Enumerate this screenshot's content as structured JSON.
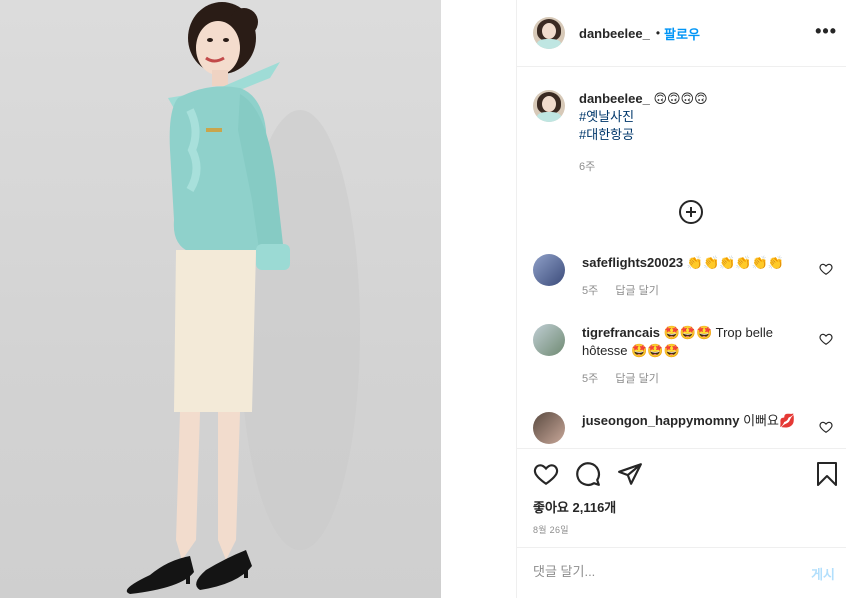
{
  "post": {
    "author": "danbeelee_",
    "dot": "•",
    "follow_label": "팔로우",
    "more_label": "•••"
  },
  "caption": {
    "author": "danbeelee_",
    "emojis": "🙃🙃🙃🙃",
    "hashtags": [
      "#옛날사진",
      "#대한항공"
    ],
    "time": "6주"
  },
  "comments": [
    {
      "user": "safeflights20023",
      "text": "👏👏👏👏👏👏",
      "time": "5주",
      "reply": "답글 달기"
    },
    {
      "user": "tigrefrancais",
      "text": "🤩🤩🤩 Trop belle hôtesse 🤩🤩🤩",
      "time": "5주",
      "reply": "답글 달기"
    },
    {
      "user": "juseongon_happymomny",
      "text": "이뻐요💋",
      "time": "",
      "reply": ""
    }
  ],
  "likes": "좋아요 2,116개",
  "date": "8월 26일",
  "comment_input": {
    "placeholder": "댓글 달기..."
  },
  "post_button": "게시",
  "icons": [
    "heart-icon",
    "comment-icon",
    "share-icon",
    "bookmark-icon",
    "plus-circle-icon"
  ],
  "colors": {
    "accent": "#0095f6",
    "uniform": "#8fd1cb",
    "skirt": "#f3ead8"
  }
}
